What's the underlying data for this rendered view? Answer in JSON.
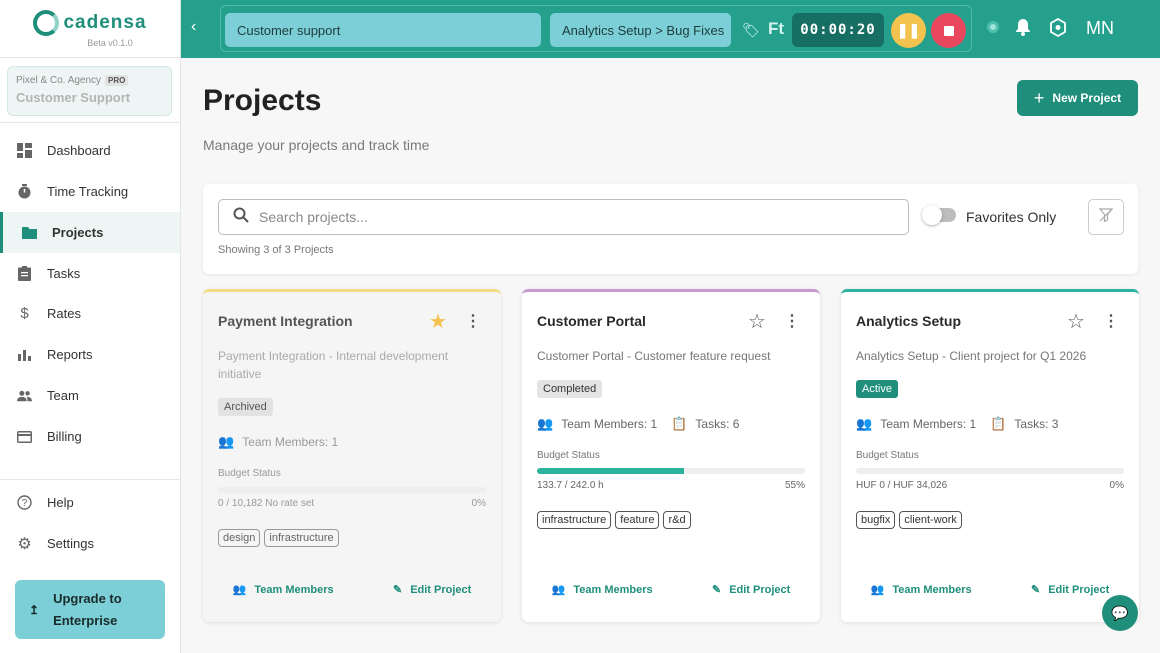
{
  "brand": {
    "name": "cadensa",
    "version": "Beta v0.1.0"
  },
  "org": {
    "agency": "Pixel & Co. Agency",
    "badge": "PRO",
    "name": "Customer Support"
  },
  "nav": {
    "items": [
      {
        "label": "Dashboard",
        "icon": "dashboard-icon"
      },
      {
        "label": "Time Tracking",
        "icon": "timer-icon"
      },
      {
        "label": "Projects",
        "icon": "folder-icon"
      },
      {
        "label": "Tasks",
        "icon": "clipboard-icon"
      },
      {
        "label": "Rates",
        "icon": "dollar-icon"
      },
      {
        "label": "Reports",
        "icon": "bar-chart-icon"
      },
      {
        "label": "Team",
        "icon": "people-icon"
      },
      {
        "label": "Billing",
        "icon": "credit-card-icon"
      }
    ],
    "bottom": [
      {
        "label": "Help",
        "icon": "help-icon"
      },
      {
        "label": "Settings",
        "icon": "gear-icon"
      }
    ],
    "upgrade": {
      "line1": "Upgrade to",
      "line2": "Enterprise"
    }
  },
  "topbar": {
    "client": "Customer support",
    "task": "Analytics Setup > Bug Fixes",
    "tag_abbrev": "Ft",
    "timer": "00:00:20",
    "avatar": "MN"
  },
  "page": {
    "title": "Projects",
    "subtitle": "Manage your projects and track time",
    "new_button": "New Project"
  },
  "filters": {
    "search_placeholder": "Search projects...",
    "showing": "Showing 3 of 3 Projects",
    "favorites_label": "Favorites Only"
  },
  "projects": [
    {
      "title": "Payment Integration",
      "description": "Payment Integration - Internal development initiative",
      "status": "Archived",
      "team": "Team Members: 1",
      "tasks": "",
      "budget_label": "Budget Status",
      "budget_text": "0 / 10,182 No rate set",
      "budget_pct": "0%",
      "budget_fraction": 0,
      "tags": [
        "design",
        "infrastructure"
      ],
      "favorite": true,
      "accent": "#f2de8a"
    },
    {
      "title": "Customer Portal",
      "description": "Customer Portal - Customer feature request",
      "status": "Completed",
      "team": "Team Members: 1",
      "tasks": "Tasks: 6",
      "budget_label": "Budget Status",
      "budget_text": "133.7 / 242.0 h",
      "budget_pct": "55%",
      "budget_fraction": 0.55,
      "tags": [
        "infrastructure",
        "feature",
        "r&d"
      ],
      "favorite": false,
      "accent": "#c79bd1"
    },
    {
      "title": "Analytics Setup",
      "description": "Analytics Setup - Client project for Q1 2026",
      "status": "Active",
      "team": "Team Members: 1",
      "tasks": "Tasks: 3",
      "budget_label": "Budget Status",
      "budget_text": "HUF 0 / HUF 34,026",
      "budget_pct": "0%",
      "budget_fraction": 0,
      "tags": [
        "bugfix",
        "client-work"
      ],
      "favorite": false,
      "accent": "#2cb39d"
    }
  ],
  "card_actions": {
    "team": "Team Members",
    "edit": "Edit Project"
  }
}
